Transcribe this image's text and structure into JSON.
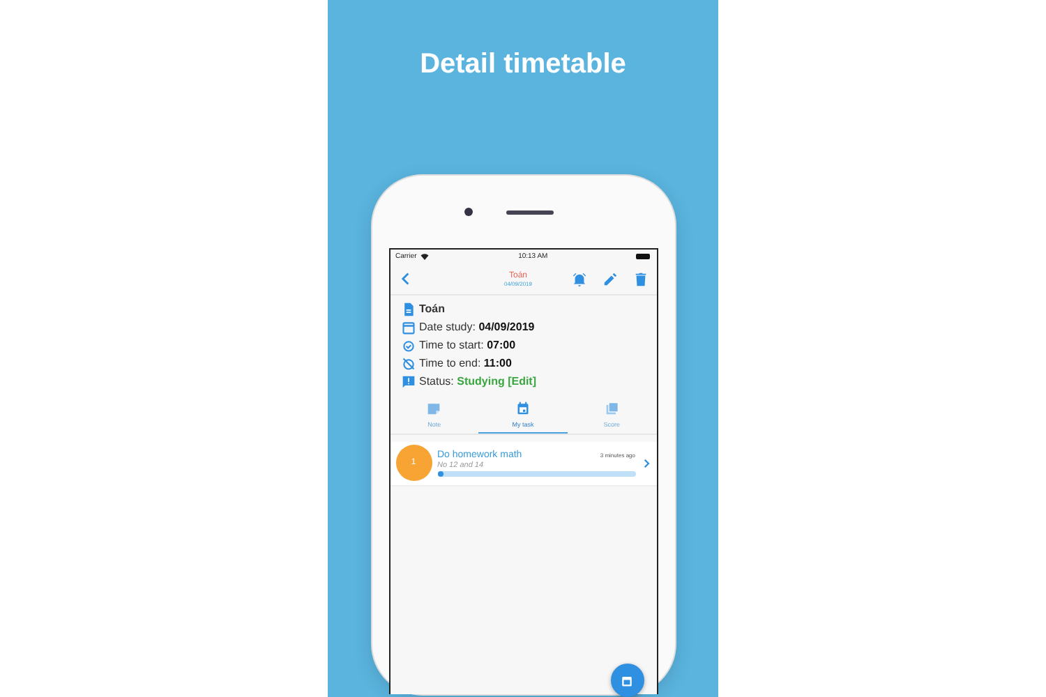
{
  "headline": "Detail timetable",
  "status_bar": {
    "carrier": "Carrier",
    "time": "10:13 AM"
  },
  "nav": {
    "title": "Toán",
    "subtitle": "04/09/2019"
  },
  "details": [
    {
      "kind": "subject",
      "label": "Toán"
    },
    {
      "kind": "date",
      "label": "Date study: ",
      "value": "04/09/2019"
    },
    {
      "kind": "start",
      "label": "Time to start: ",
      "value": "07:00"
    },
    {
      "kind": "end",
      "label": "Time to end: ",
      "value": "11:00"
    },
    {
      "kind": "status",
      "label": "Status: ",
      "value": "Studying [Edit]"
    }
  ],
  "tabs": [
    {
      "label": "Note",
      "kind": "note",
      "selected": false
    },
    {
      "label": "My task",
      "kind": "calendar",
      "selected": true
    },
    {
      "label": "Score",
      "kind": "score",
      "selected": false
    }
  ],
  "tasks": [
    {
      "number": "1",
      "title": "Do homework math",
      "note": "No 12 and 14",
      "time": "3 minutes ago",
      "level": 0.02
    }
  ]
}
